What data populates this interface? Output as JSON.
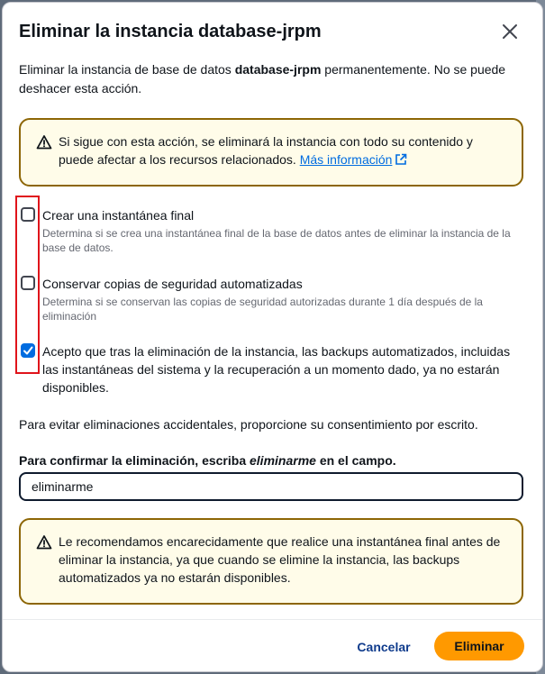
{
  "modal": {
    "title": "Eliminar la instancia database-jrpm",
    "description_prefix": "Eliminar la instancia de base de datos ",
    "description_bold": "database-jrpm",
    "description_suffix": " permanentemente. No se puede deshacer esta acción."
  },
  "alert_top": {
    "text": "Si sigue con esta acción, se eliminará la instancia con todo su contenido y puede afectar a los recursos relacionados. ",
    "link_label": "Más información",
    "icon": "warning-icon",
    "link_icon": "external-link-icon"
  },
  "options": [
    {
      "label": "Crear una instantánea final",
      "description": "Determina si se crea una instantánea final de la base de datos antes de eliminar la instancia de la base de datos.",
      "checked": false
    },
    {
      "label": "Conservar copias de seguridad automatizadas",
      "description": "Determina si se conservan las copias de seguridad autorizadas durante 1 día después de la eliminación",
      "checked": false
    },
    {
      "label": "Acepto que tras la eliminación de la instancia, las backups automatizados, incluidas las instantáneas del sistema y la recuperación a un momento dado, ya no estarán disponibles.",
      "description": "",
      "checked": true
    }
  ],
  "note": "Para evitar eliminaciones accidentales, proporcione su consentimiento por escrito.",
  "confirm": {
    "label_prefix": "Para confirmar la eliminación, escriba ",
    "label_keyword": "eliminarme",
    "label_suffix": " en el campo.",
    "value": "eliminarme"
  },
  "alert_bottom": {
    "text": "Le recomendamos encarecidamente que realice una instantánea final antes de eliminar la instancia, ya que cuando se elimine la instancia, las backups automatizados ya no estarán disponibles.",
    "icon": "warning-icon"
  },
  "footer": {
    "cancel_label": "Cancelar",
    "delete_label": "Eliminar"
  },
  "colors": {
    "accent": "#006ce0",
    "warning_border": "#8d6605",
    "warning_bg": "#fffce9",
    "primary_button": "#ff9900",
    "highlight_box": "#e0141b"
  }
}
